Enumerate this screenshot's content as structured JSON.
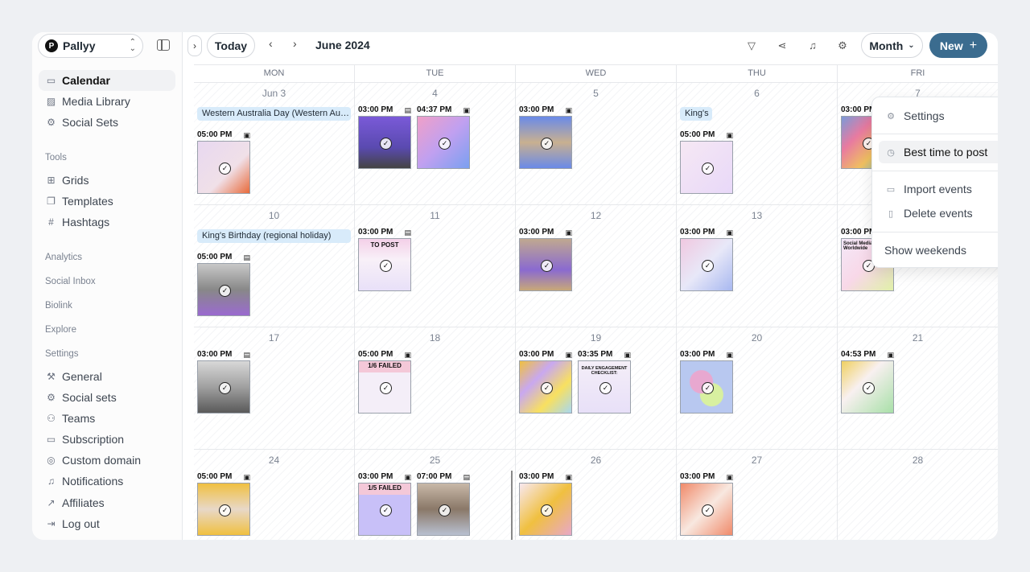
{
  "workspace": {
    "name": "Pallyy",
    "logo_letter": "P"
  },
  "sidebar": {
    "main": [
      {
        "label": "Calendar",
        "icon": "calendar-icon",
        "active": true
      },
      {
        "label": "Media Library",
        "icon": "image-icon"
      },
      {
        "label": "Social Sets",
        "icon": "gear-icon"
      }
    ],
    "tools_header": "Tools",
    "tools": [
      {
        "label": "Grids",
        "icon": "grid-icon"
      },
      {
        "label": "Templates",
        "icon": "copy-icon"
      },
      {
        "label": "Hashtags",
        "icon": "hash-icon"
      }
    ],
    "sections": [
      "Analytics",
      "Social Inbox",
      "Biolink",
      "Explore"
    ],
    "settings_header": "Settings",
    "settings": [
      {
        "label": "General",
        "icon": "wrench-icon"
      },
      {
        "label": "Social sets",
        "icon": "gear-icon"
      },
      {
        "label": "Teams",
        "icon": "users-icon"
      },
      {
        "label": "Subscription",
        "icon": "card-icon"
      },
      {
        "label": "Custom domain",
        "icon": "globe-icon"
      },
      {
        "label": "Notifications",
        "icon": "bell-icon"
      },
      {
        "label": "Affiliates",
        "icon": "external-link-icon"
      },
      {
        "label": "Log out",
        "icon": "logout-icon"
      }
    ]
  },
  "toolbar": {
    "today_label": "Today",
    "period_label": "June 2024",
    "view_label": "Month",
    "new_label": "New"
  },
  "calendar": {
    "weekdays": [
      "MON",
      "TUE",
      "WED",
      "THU",
      "FRI"
    ],
    "weeks": [
      [
        "Jun 3",
        "4",
        "5",
        "6",
        "7"
      ],
      [
        "10",
        "11",
        "12",
        "13",
        "14"
      ],
      [
        "17",
        "18",
        "19",
        "20",
        "21"
      ],
      [
        "24",
        "25",
        "26",
        "27",
        "28"
      ]
    ],
    "holidays": {
      "w0d0": "Western Australia Day (Western Aus…",
      "w0d3": "King's",
      "w1d0": "King's Birthday (regional holiday)"
    },
    "posts": {
      "w0d0a": {
        "time": "05:00 PM"
      },
      "w0d1a": {
        "time": "03:00 PM"
      },
      "w0d1b": {
        "time": "04:37 PM"
      },
      "w0d2a": {
        "time": "03:00 PM"
      },
      "w0d3a": {
        "time": "05:00 PM"
      },
      "w0d4a": {
        "time": "03:00 PM"
      },
      "w1d0a": {
        "time": "05:00 PM"
      },
      "w1d1a": {
        "time": "03:00 PM",
        "caption": "TO POST"
      },
      "w1d2a": {
        "time": "03:00 PM"
      },
      "w1d3a": {
        "time": "03:00 PM"
      },
      "w1d4a": {
        "time": "03:00 PM",
        "caption": "Social Media Usage Worldwide"
      },
      "w2d0a": {
        "time": "03:00 PM"
      },
      "w2d1a": {
        "time": "05:00 PM",
        "caption": "1/6 FAILED"
      },
      "w2d2a": {
        "time": "03:00 PM"
      },
      "w2d2b": {
        "time": "03:35 PM",
        "caption": "DAILY ENGAGEMENT CHECKLIST:"
      },
      "w2d3a": {
        "time": "03:00 PM"
      },
      "w2d4a": {
        "time": "04:53 PM"
      },
      "w3d0a": {
        "time": "05:00 PM"
      },
      "w3d1a": {
        "time": "03:00 PM",
        "caption": "1/5 FAILED"
      },
      "w3d1b": {
        "time": "07:00 PM"
      },
      "w3d2a": {
        "time": "03:00 PM"
      },
      "w3d3a": {
        "time": "03:00 PM"
      }
    }
  },
  "menu": {
    "settings": "Settings",
    "best_time": "Best time to post",
    "import": "Import events",
    "delete": "Delete events",
    "weekends": "Show weekends"
  },
  "colors": {
    "accent": "#3b6c8f",
    "holiday_bg": "#d8ebfa",
    "active_bg": "#f1f2f4"
  }
}
